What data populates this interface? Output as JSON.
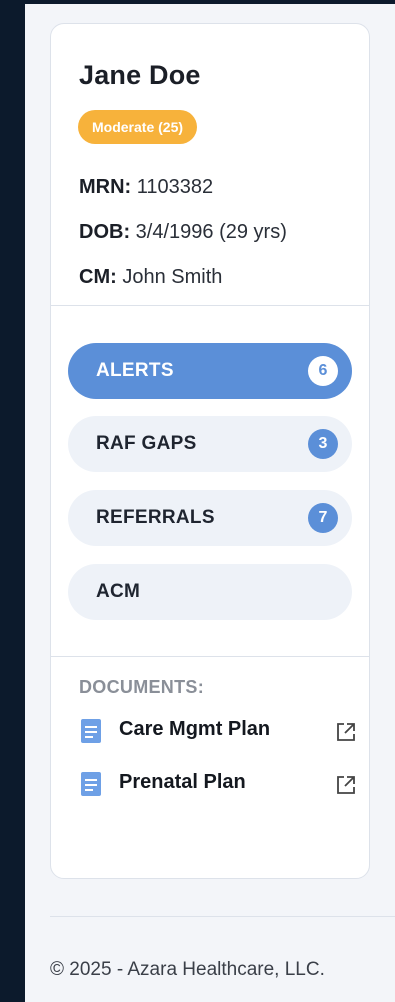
{
  "patient": {
    "name": "Jane Doe",
    "risk_badge": "Moderate (25)",
    "mrn_label": "MRN:",
    "mrn": "1103382",
    "dob_label": "DOB:",
    "dob": "3/4/1996 (29 yrs)",
    "cm_label": "CM:",
    "cm": "John Smith"
  },
  "nav": {
    "items": [
      {
        "label": "ALERTS",
        "count": "6",
        "active": true
      },
      {
        "label": "RAF GAPS",
        "count": "3",
        "active": false
      },
      {
        "label": "REFERRALS",
        "count": "7",
        "active": false
      },
      {
        "label": "ACM",
        "count": "",
        "active": false
      }
    ]
  },
  "documents": {
    "heading": "DOCUMENTS:",
    "items": [
      {
        "label": "Care Mgmt Plan",
        "icon": "document-icon",
        "link_icon": "external-link-icon"
      },
      {
        "label": "Prenatal Plan",
        "icon": "document-icon",
        "link_icon": "external-link-icon"
      }
    ]
  },
  "footer": {
    "text": "© 2025 - Azara Healthcare, LLC."
  },
  "colors": {
    "accent": "#5b8fd8",
    "risk_moderate": "#f7b23b",
    "sidebar_bg": "#0c1a2c"
  }
}
